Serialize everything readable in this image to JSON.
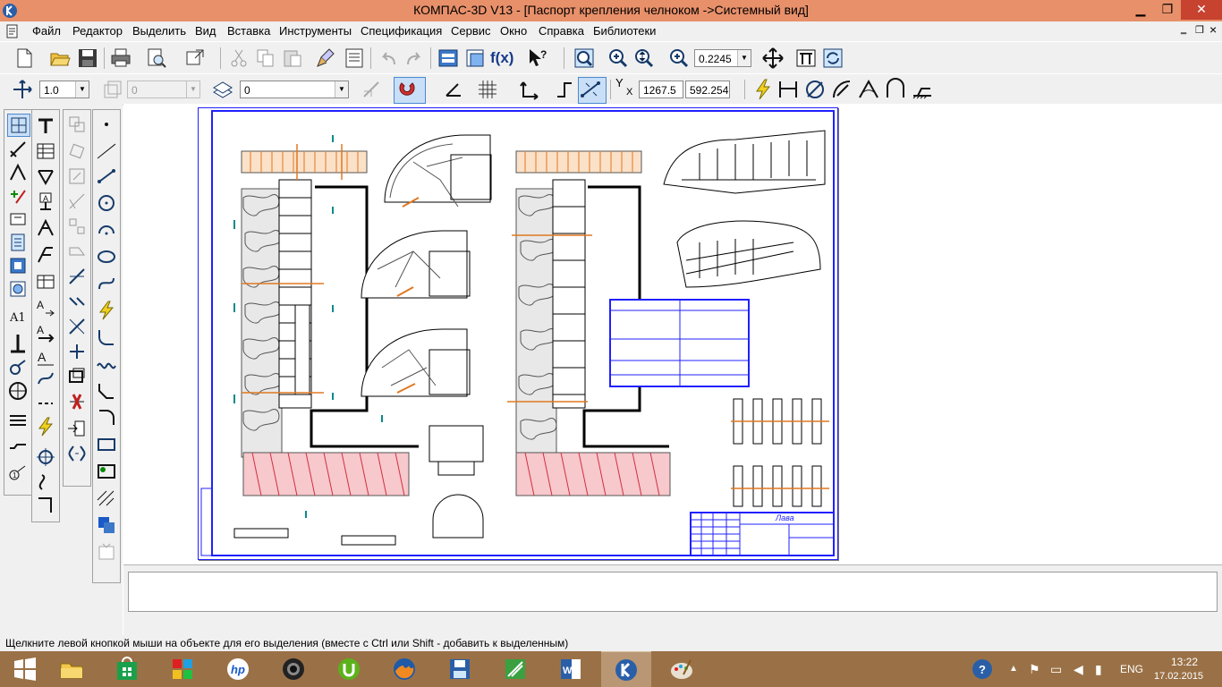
{
  "window": {
    "title": "КОМПАС-3D V13 - [Паспорт крепления челноком ->Системный вид]",
    "minimize_glyph": "▁",
    "restore_glyph": "❐",
    "close_glyph": "✕"
  },
  "menu": {
    "items": [
      "Файл",
      "Редактор",
      "Выделить",
      "Вид",
      "Вставка",
      "Инструменты",
      "Спецификация",
      "Сервис",
      "Окно",
      "Справка",
      "Библиотеки"
    ],
    "mdi_minimize": "‗",
    "mdi_restore": "❐",
    "mdi_close": "×"
  },
  "toolbar": {
    "zoom_value": "0.2245",
    "step_value": "1.0",
    "angle_value": "0",
    "layer_value": "0",
    "coord_x": "1267.5",
    "coord_y": "592.254",
    "coord_label_y": "Y",
    "coord_label_x": "X",
    "fx_label": "f(x)"
  },
  "drawing": {
    "title_block_text": "Лава"
  },
  "status": {
    "message": "Щелкните левой кнопкой мыши на объекте для его выделения (вместе с Ctrl или Shift - добавить к выделенным)"
  },
  "taskbar": {
    "apps": [
      "start-windows-icon",
      "file-explorer-icon",
      "store-icon",
      "games-icon",
      "hp-icon",
      "camera-icon",
      "utorrent-icon",
      "firefox-icon",
      "save-floppy-icon",
      "green-app-icon",
      "word-icon",
      "kompas-icon",
      "paint-icon"
    ],
    "language": "ENG",
    "time": "13:22",
    "date": "17.02.2015"
  },
  "colors": {
    "titlebar": "#e8906a",
    "close_button": "#c7422f",
    "taskbar": "#9a7146",
    "sheet_border": "#2020ff"
  }
}
